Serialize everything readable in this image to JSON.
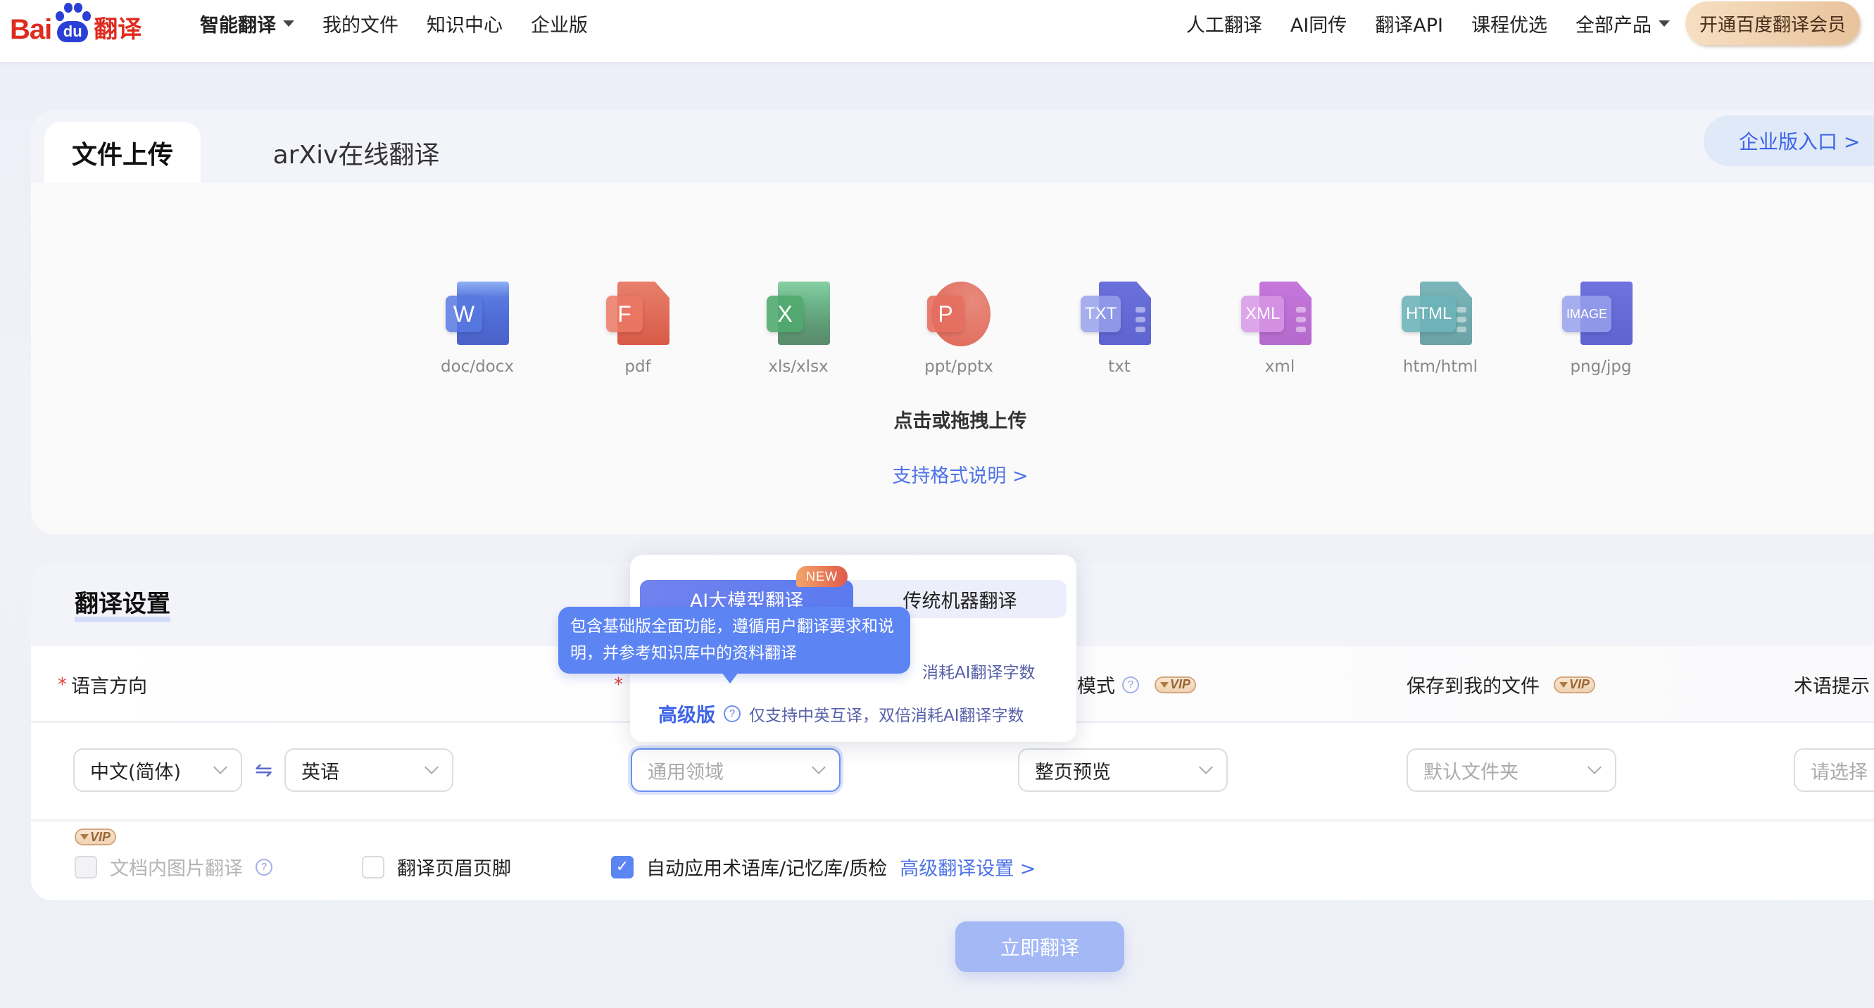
{
  "header": {
    "logo": {
      "text_left": "Bai",
      "text_paw": "du",
      "text_right": "翻译"
    },
    "nav_left": [
      {
        "label": "智能翻译",
        "has_dropdown": true,
        "bold": true
      },
      {
        "label": "我的文件",
        "has_dropdown": false
      },
      {
        "label": "知识中心",
        "has_dropdown": false
      },
      {
        "label": "企业版",
        "has_dropdown": false
      }
    ],
    "nav_right": [
      {
        "label": "人工翻译",
        "has_dropdown": false
      },
      {
        "label": "AI同传",
        "has_dropdown": false
      },
      {
        "label": "翻译API",
        "has_dropdown": false
      },
      {
        "label": "课程优选",
        "has_dropdown": false
      },
      {
        "label": "全部产品",
        "has_dropdown": true
      }
    ],
    "vip_button": "开通百度翻译会员"
  },
  "upload": {
    "tabs": [
      {
        "label": "文件上传",
        "active": true
      },
      {
        "label": "arXiv在线翻译",
        "active": false
      }
    ],
    "enterprise_entry": "企业版入口 >",
    "formats": [
      {
        "label": "doc/docx",
        "badge": "W",
        "icon": "word-file-icon",
        "color": "#4f6fd8"
      },
      {
        "label": "pdf",
        "badge": "F",
        "icon": "pdf-file-icon",
        "color": "#e0634f"
      },
      {
        "label": "xls/xlsx",
        "badge": "X",
        "icon": "excel-file-icon",
        "color": "#4f9d70"
      },
      {
        "label": "ppt/pptx",
        "badge": "P",
        "icon": "ppt-file-icon",
        "color": "#e0685a"
      },
      {
        "label": "txt",
        "badge": "TXT",
        "icon": "txt-file-icon",
        "color": "#6670d8"
      },
      {
        "label": "xml",
        "badge": "XML",
        "icon": "xml-file-icon",
        "color": "#c070d6"
      },
      {
        "label": "htm/html",
        "badge": "HTML",
        "icon": "html-file-icon",
        "color": "#6fadb0"
      },
      {
        "label": "png/jpg",
        "badge": "IMAGE",
        "icon": "image-file-icon",
        "color": "#6b6fdc"
      }
    ],
    "hint": "点击或拖拽上传",
    "format_link": "支持格式说明 >"
  },
  "settings": {
    "title": "翻译设置",
    "labels": {
      "language": "语言方向",
      "mode_suffix": "模式",
      "save_to": "保存到我的文件",
      "term": "术语提示"
    },
    "vip_tag": "VIP",
    "source_language": "中文(简体)",
    "target_language": "英语",
    "swap_symbol": "⇋",
    "domain_placeholder": "通用领域",
    "preview_mode": "整页预览",
    "folder_placeholder": "默认文件夹",
    "term_placeholder": "请选择",
    "checkboxes": [
      {
        "label": "文档内图片翻译",
        "checked": false,
        "disabled": true,
        "vip": true
      },
      {
        "label": "翻译页眉页脚",
        "checked": false,
        "disabled": false
      },
      {
        "label": "自动应用术语库/记忆库/质检",
        "checked": true,
        "disabled": false
      }
    ],
    "advanced_link": "高级翻译设置 >"
  },
  "translate_button": "立即翻译",
  "engine_popup": {
    "options": [
      {
        "label": "AI大模型翻译",
        "active": true,
        "tag": "NEW"
      },
      {
        "label": "传统机器翻译",
        "active": false
      }
    ],
    "basic_desc": "消耗AI翻译字数",
    "advanced": {
      "name": "高级版",
      "desc": "仅支持中英互译，双倍消耗AI翻译字数"
    }
  },
  "tooltip": "包含基础版全面功能，遵循用户翻译要求和说明，并参考知识库中的资料翻译"
}
